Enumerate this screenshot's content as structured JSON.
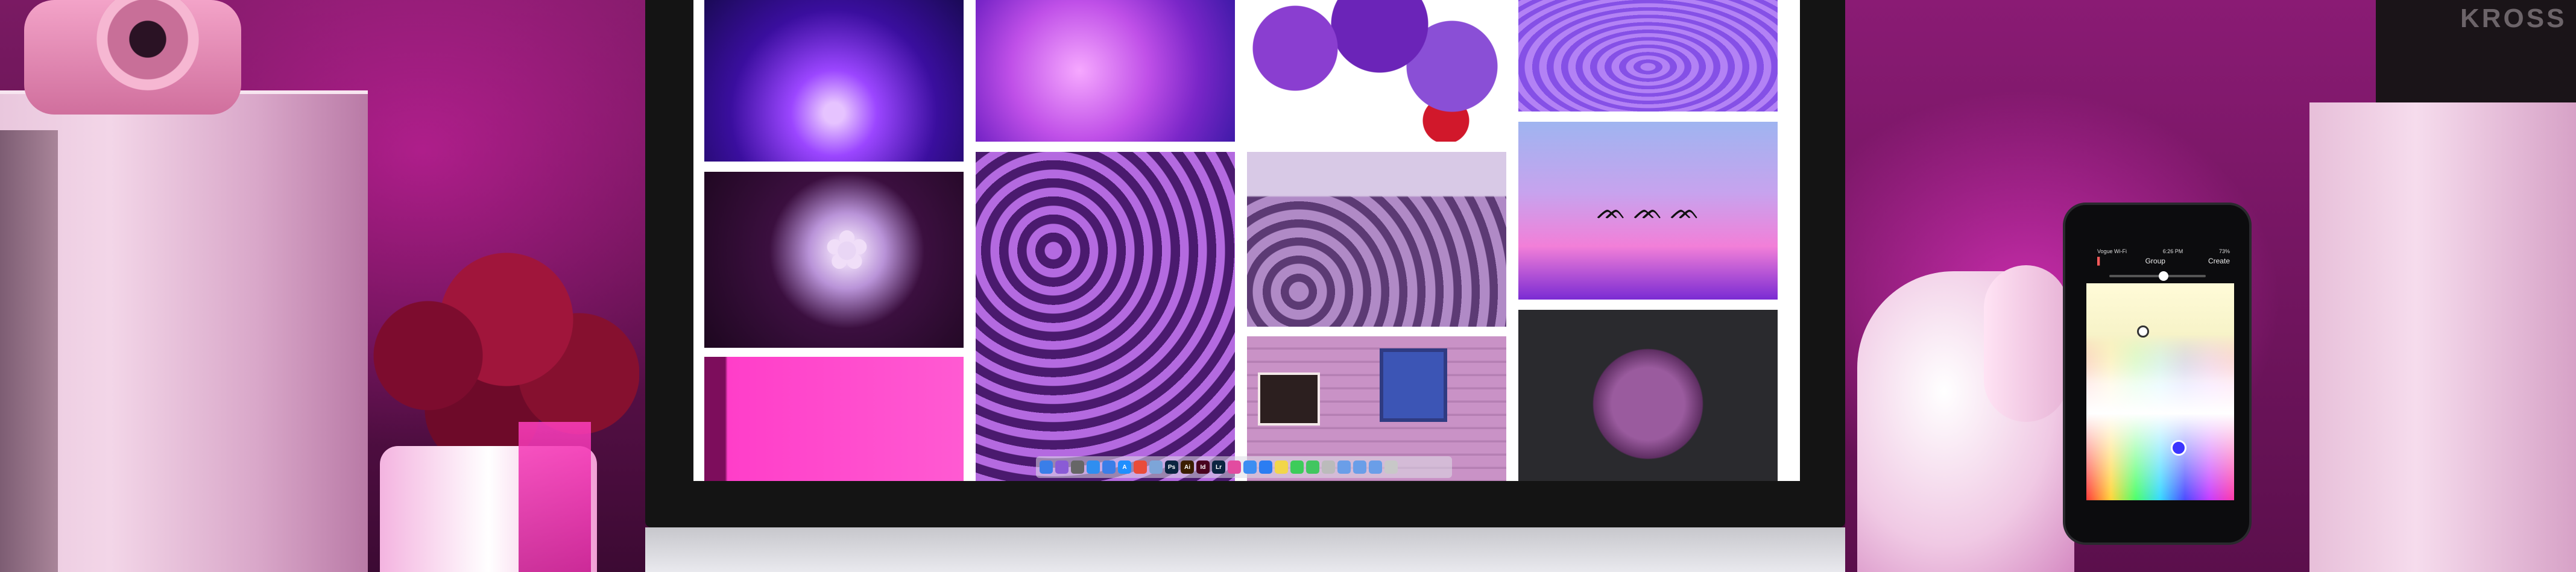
{
  "scene": {
    "description_colors": {
      "accent": "#ff2fcf",
      "wall": "#5a1248"
    }
  },
  "dock": {
    "icons": [
      {
        "name": "finder-icon",
        "color": "#3a7ee8",
        "label": ""
      },
      {
        "name": "siri-icon",
        "color": "#8a5bd6",
        "label": ""
      },
      {
        "name": "launchpad-icon",
        "color": "#666",
        "label": ""
      },
      {
        "name": "safari-icon",
        "color": "#2f8ef0",
        "label": ""
      },
      {
        "name": "mail-icon",
        "color": "#3a7ee8",
        "label": ""
      },
      {
        "name": "appstore-icon",
        "color": "#1f8fff",
        "label": "A"
      },
      {
        "name": "chrome-icon",
        "color": "#e94c3a",
        "label": ""
      },
      {
        "name": "preview-icon",
        "color": "#7da5d8",
        "label": ""
      },
      {
        "name": "photoshop-icon",
        "color": "#0b2440",
        "label": "Ps"
      },
      {
        "name": "illustrator-icon",
        "color": "#3a1d00",
        "label": "Ai"
      },
      {
        "name": "indesign-icon",
        "color": "#49021f",
        "label": "Id"
      },
      {
        "name": "lightroom-icon",
        "color": "#0b2440",
        "label": "Lr"
      },
      {
        "name": "itunes-icon",
        "color": "#e24ca0",
        "label": ""
      },
      {
        "name": "cloud-icon",
        "color": "#3d8ef2",
        "label": ""
      },
      {
        "name": "dropbox-icon",
        "color": "#2b7df2",
        "label": ""
      },
      {
        "name": "notes-icon",
        "color": "#f2d64a",
        "label": ""
      },
      {
        "name": "messages-icon",
        "color": "#3dcc5a",
        "label": ""
      },
      {
        "name": "facetime-icon",
        "color": "#42c660",
        "label": ""
      },
      {
        "name": "document-icon",
        "color": "#bbbbbb",
        "label": ""
      },
      {
        "name": "folder-icon",
        "color": "#6a9ee8",
        "label": ""
      },
      {
        "name": "folder-icon",
        "color": "#6a9ee8",
        "label": ""
      },
      {
        "name": "downloads-icon",
        "color": "#6a9ee8",
        "label": ""
      },
      {
        "name": "trash-icon",
        "color": "#c8c8c8",
        "label": ""
      }
    ]
  },
  "phone": {
    "status_left": "Vogue Wi-Fi",
    "status_time": "6:26 PM",
    "status_right": "73%",
    "back_label": "",
    "title": "Group",
    "action": "Create"
  },
  "speaker": {
    "brand_text": "KROSS"
  }
}
